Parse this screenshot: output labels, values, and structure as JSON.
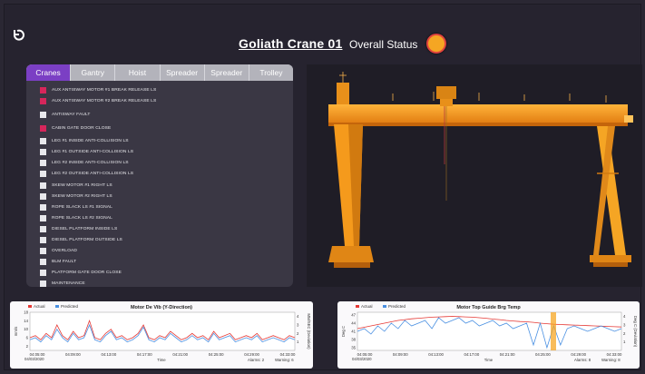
{
  "header": {
    "title": "Goliath Crane 01",
    "status_label": "Overall Status",
    "status_color": "#f5a623"
  },
  "panel": {
    "tabs": [
      {
        "label": "Cranes",
        "active": true
      },
      {
        "label": "Gantry",
        "active": false
      },
      {
        "label": "Hoist",
        "active": false
      },
      {
        "label": "Spreader",
        "active": false
      },
      {
        "label": "Spreader",
        "active": false
      },
      {
        "label": "Trolley",
        "active": false
      }
    ],
    "items": [
      {
        "label": "AUX ANTISWAY MOTOR #1 BREAK RELEASE LS",
        "active": true
      },
      {
        "label": "AUX ANTISWAY MOTOR #2 BREAK RELEASE LS",
        "active": true
      },
      {
        "label": "ANTISWAY FAULT",
        "active": false
      },
      {
        "label": "CABIN GATE DOOR CLOSE",
        "active": true
      },
      {
        "label": "LEG #1 INSIDE ANTI-COLLISION LS",
        "active": false
      },
      {
        "label": "LEG #1 OUTSIDE ANTI-COLLISION LS",
        "active": false
      },
      {
        "label": "LEG #2 INSIDE ANTI-COLLISION LS",
        "active": false
      },
      {
        "label": "LEG #2 OUTSIDE ANTI-COLLISION LS",
        "active": false
      },
      {
        "label": "SKEW MOTOR #1 RIGHT LS",
        "active": false
      },
      {
        "label": "SKEW MOTOR #2 RIGHT LS",
        "active": false
      },
      {
        "label": "ROPE SLACK LS #1 SIGNAL",
        "active": false
      },
      {
        "label": "ROPE SLACK LS #2 SIGNAL",
        "active": false
      },
      {
        "label": "DIESEL PLATFORM INSIDE LS",
        "active": false
      },
      {
        "label": "DIESEL PLATFORM OUTSIDE LS",
        "active": false
      },
      {
        "label": "OVERLOAD",
        "active": false
      },
      {
        "label": "BLM FAULT",
        "active": false
      },
      {
        "label": "PLATFORM GATE DOOR CLOSE",
        "active": false
      },
      {
        "label": "MAINTENANCE",
        "active": false
      }
    ]
  },
  "colors": {
    "accent": "#7b3fc4",
    "alarm": "#d6265b",
    "crane": "#f59a1c",
    "actual": "#e53935",
    "predicted": "#4a90e2"
  },
  "chart_data": [
    {
      "type": "line",
      "title": "Motor De Vib (Y-Direction)",
      "legend": [
        "Actual",
        "Predicted"
      ],
      "xlabel": "Time",
      "ylabel": "mm/s",
      "y2label": "MM/SEC (Deviation)",
      "date": "04/03/2020",
      "x_ticks": [
        "04:05:00",
        "04:09:00",
        "04:13:00",
        "04:17:00",
        "04:21:00",
        "04:25:00",
        "04:29:00",
        "04:33:00"
      ],
      "y_ticks": [
        2,
        6,
        10,
        14,
        18
      ],
      "y2_ticks": [
        1,
        2,
        3,
        4
      ],
      "ylim": [
        0,
        18
      ],
      "alarms": "Alarms: 2",
      "warnings": "Warning: 6",
      "series": [
        {
          "name": "Actual",
          "values": [
            6,
            7,
            5,
            8,
            6,
            12,
            7,
            5,
            9,
            6,
            7,
            14,
            6,
            5,
            8,
            10,
            6,
            7,
            5,
            6,
            8,
            12,
            6,
            5,
            7,
            6,
            9,
            7,
            5,
            6,
            8,
            6,
            7,
            5,
            9,
            6,
            7,
            8,
            5,
            6,
            7,
            6,
            8,
            5,
            6,
            7,
            6,
            5,
            7,
            6
          ]
        },
        {
          "name": "Predicted",
          "values": [
            5,
            6,
            4,
            7,
            5,
            10,
            6,
            4,
            8,
            5,
            6,
            12,
            5,
            4,
            7,
            9,
            5,
            6,
            4,
            5,
            7,
            11,
            5,
            4,
            6,
            5,
            8,
            6,
            4,
            5,
            7,
            5,
            6,
            4,
            8,
            5,
            6,
            7,
            4,
            5,
            6,
            5,
            7,
            4,
            5,
            6,
            5,
            4,
            6,
            5
          ]
        }
      ]
    },
    {
      "type": "line",
      "title": "Motor Top Guide Brg Temp",
      "legend": [
        "Actual",
        "Predicted"
      ],
      "xlabel": "Time",
      "ylabel": "Deg C",
      "y2label": "Deg C (Deviation)",
      "date": "04/03/2020",
      "x_ticks": [
        "04:05:00",
        "04:09:00",
        "04:13:00",
        "04:17:00",
        "04:21:00",
        "04:25:00",
        "04:29:00",
        "04:33:00"
      ],
      "y_ticks": [
        35,
        38,
        41,
        44,
        47
      ],
      "y2_ticks": [
        1,
        2,
        3,
        4
      ],
      "ylim": [
        34,
        48
      ],
      "alarms": "Alarms: 8",
      "warnings": "Warning: 8",
      "series": [
        {
          "name": "Actual",
          "values": [
            42,
            42.5,
            43,
            43.5,
            44,
            44.5,
            45,
            45.3,
            45.6,
            45.8,
            46,
            46.2,
            46.3,
            46.4,
            46.5,
            46.4,
            46.3,
            46.2,
            46,
            45.8,
            45.5,
            45.3,
            45,
            44.8,
            44.6,
            44.5,
            44.3,
            44,
            43.8,
            43.6,
            43.5,
            43.4,
            43.3,
            43.2,
            43.1,
            43,
            42.9,
            42.8,
            42.7,
            42.6
          ]
        },
        {
          "name": "Predicted",
          "values": [
            41,
            42,
            40,
            43,
            41,
            44,
            42,
            45,
            43,
            44,
            45,
            42,
            46,
            44,
            45,
            46,
            44,
            45,
            43,
            44,
            45,
            43,
            44,
            42,
            43,
            44,
            36,
            44,
            35,
            43,
            36,
            42,
            43,
            42,
            41,
            42,
            43,
            42,
            41,
            42
          ]
        }
      ]
    }
  ]
}
